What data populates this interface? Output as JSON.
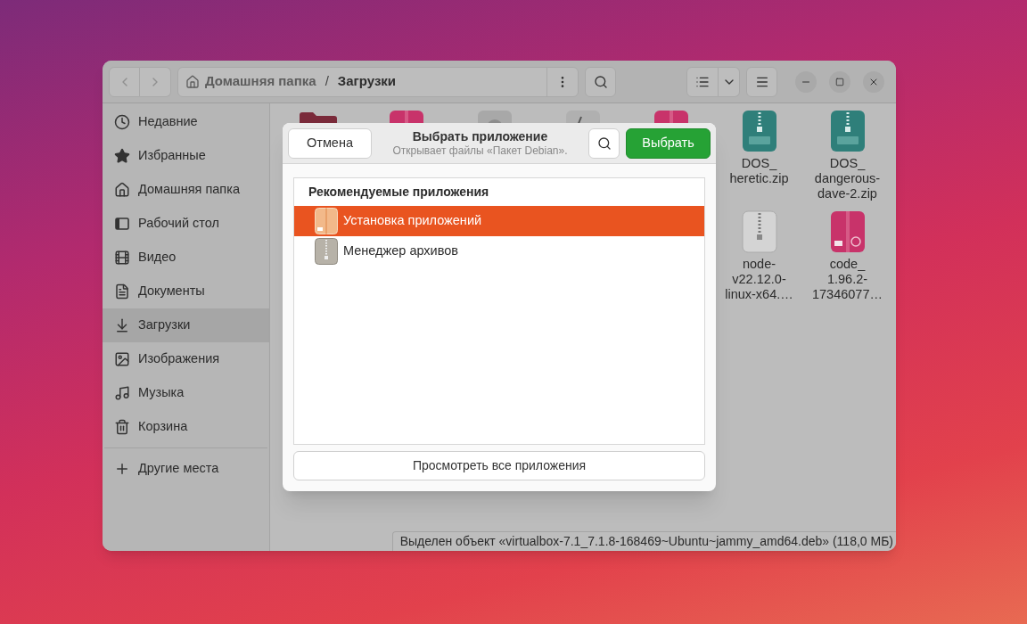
{
  "window": {
    "nav": {
      "back_disabled": true,
      "forward_disabled": true
    },
    "path_separator": "/",
    "path": [
      {
        "label": "Домашняя папка",
        "kind": "home",
        "current": false
      },
      {
        "label": "Загрузки",
        "kind": "folder",
        "current": true
      }
    ]
  },
  "sidebar": {
    "items": [
      {
        "label": "Недавние",
        "kind": "recent",
        "selected": false
      },
      {
        "label": "Избранные",
        "kind": "starred",
        "selected": false
      },
      {
        "label": "Домашняя папка",
        "kind": "home",
        "selected": false
      },
      {
        "label": "Рабочий стол",
        "kind": "desktop",
        "selected": false
      },
      {
        "label": "Видео",
        "kind": "videos",
        "selected": false
      },
      {
        "label": "Документы",
        "kind": "documents",
        "selected": false
      },
      {
        "label": "Загрузки",
        "kind": "downloads",
        "selected": true
      },
      {
        "label": "Изображения",
        "kind": "pictures",
        "selected": false
      },
      {
        "label": "Музыка",
        "kind": "music",
        "selected": false
      },
      {
        "label": "Корзина",
        "kind": "trash",
        "selected": false
      }
    ],
    "other": {
      "label": "Другие места"
    }
  },
  "files": {
    "rows": [
      [
        {
          "kind": "folder"
        },
        {
          "kind": "deb"
        },
        {
          "kind": "disc"
        },
        {
          "kind": "script"
        },
        {
          "kind": "deb"
        },
        {
          "kind": "zip-teal",
          "label": "DOS_\nheretic.zip"
        },
        {
          "kind": "zip-teal",
          "label": "DOS_\ndangerous-\ndave-2.zip"
        }
      ],
      [
        {
          "kind": "zip-grey",
          "label": "node-\nv22.12.0-\nlinux-x64.…"
        },
        {
          "kind": "deb",
          "label": "code_\n1.96.2-\n17346077…"
        }
      ]
    ]
  },
  "status_bar": "Выделен объект «virtualbox-7.1_7.1.8-168469~Ubuntu~jammy_amd64.deb» (118,0 МБ)",
  "dialog": {
    "cancel": "Отмена",
    "title": "Выбрать приложение",
    "subtitle": "Открывает файлы «Пакет Debian».",
    "confirm": "Выбрать",
    "section": "Рекомендуемые приложения",
    "apps": [
      {
        "label": "Установка приложений",
        "kind": "installer",
        "selected": true
      },
      {
        "label": "Менеджер архивов",
        "kind": "archive",
        "selected": false
      }
    ],
    "view_all": "Просмотреть все приложения"
  }
}
